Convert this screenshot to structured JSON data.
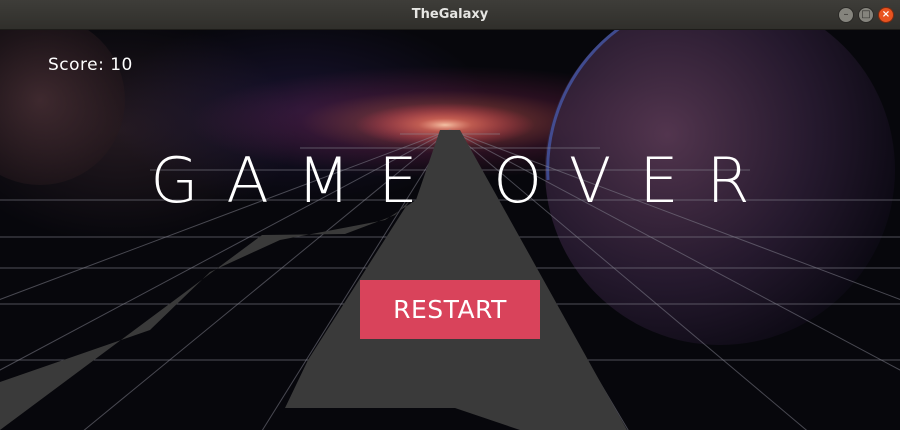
{
  "window": {
    "title": "TheGalaxy"
  },
  "hud": {
    "score": "Score: 10"
  },
  "overlay": {
    "heading": "GAME OVER",
    "restart_label": "RESTART"
  },
  "colors": {
    "restart_button": "#d9435b",
    "track": "#3a3a3a",
    "grid_lines": "#8a8a96",
    "background": "#07070c"
  }
}
